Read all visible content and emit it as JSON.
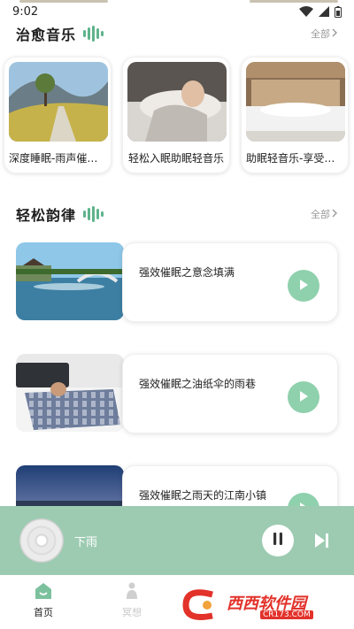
{
  "status_bar": {
    "time": "9:02"
  },
  "section_healing": {
    "title": "治愈音乐",
    "see_all": "全部"
  },
  "albums": [
    {
      "title": "深度睡眠-雨声催眠曲"
    },
    {
      "title": "轻松入眠助眠轻音乐"
    },
    {
      "title": "助眠轻音乐-享受好梦"
    }
  ],
  "section_rhythm": {
    "title": "轻松韵律",
    "see_all": "全部"
  },
  "tracks": [
    {
      "title": "强效催眠之意念填满"
    },
    {
      "title": "强效催眠之油纸伞的雨巷"
    },
    {
      "title": "强效催眠之雨天的江南小镇"
    }
  ],
  "player": {
    "now_playing": "下雨"
  },
  "nav": {
    "home": "首页",
    "meditate": "冥想"
  },
  "watermark": {
    "text": "西西软件园",
    "url": "CR173.COM"
  },
  "colors": {
    "accent": "#8fd0ad",
    "player_bg": "#9ccbb1",
    "title_icon": "#5fb38c"
  },
  "icons": {
    "see_all": "chevron-right-icon",
    "section": "sound-wave-icon",
    "play": "play-icon",
    "pause": "pause-icon",
    "next": "skip-next-icon",
    "home": "home-icon",
    "meditate": "meditation-icon"
  }
}
